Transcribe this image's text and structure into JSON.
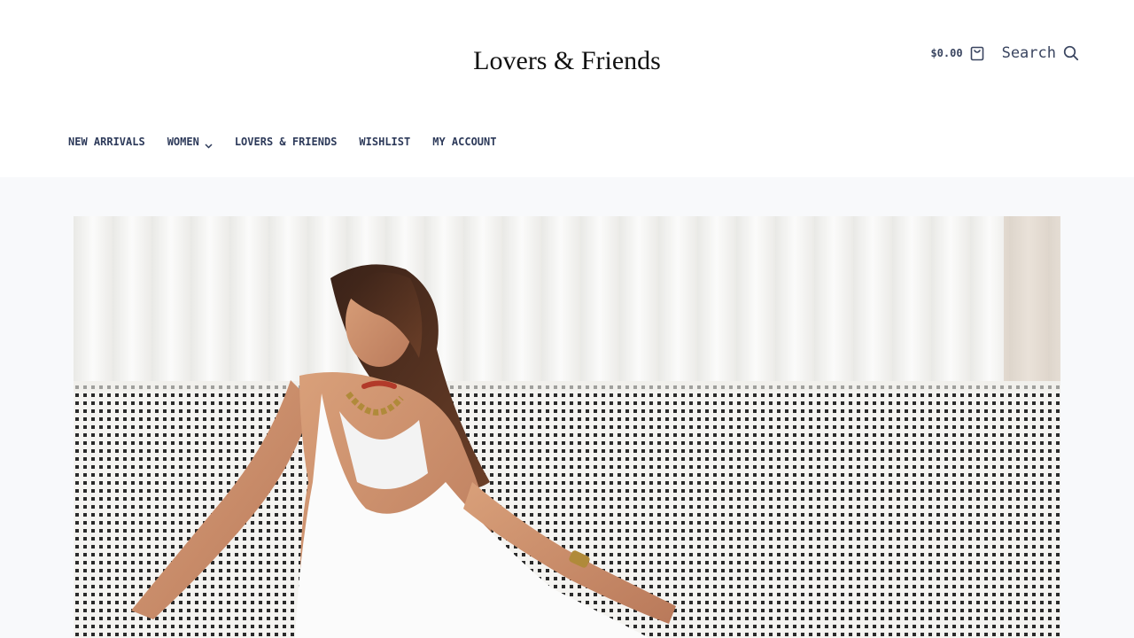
{
  "brand": {
    "logo_text": "Lovers & Friends"
  },
  "header": {
    "cart_total": "$0.00",
    "cart_icon": "shopping-bag-icon",
    "search_label": "Search",
    "search_icon": "search-icon"
  },
  "nav": {
    "items": [
      {
        "label": "NEW ARRIVALS",
        "has_dropdown": false
      },
      {
        "label": "WOMEN",
        "has_dropdown": true
      },
      {
        "label": "LOVERS & FRIENDS",
        "has_dropdown": false
      },
      {
        "label": "WISHLIST",
        "has_dropdown": false
      },
      {
        "label": "MY ACCOUNT",
        "has_dropdown": false
      }
    ]
  },
  "colors": {
    "text": "#2d3a5a",
    "page_background": "#f8f9fb",
    "header_background": "#ffffff"
  }
}
